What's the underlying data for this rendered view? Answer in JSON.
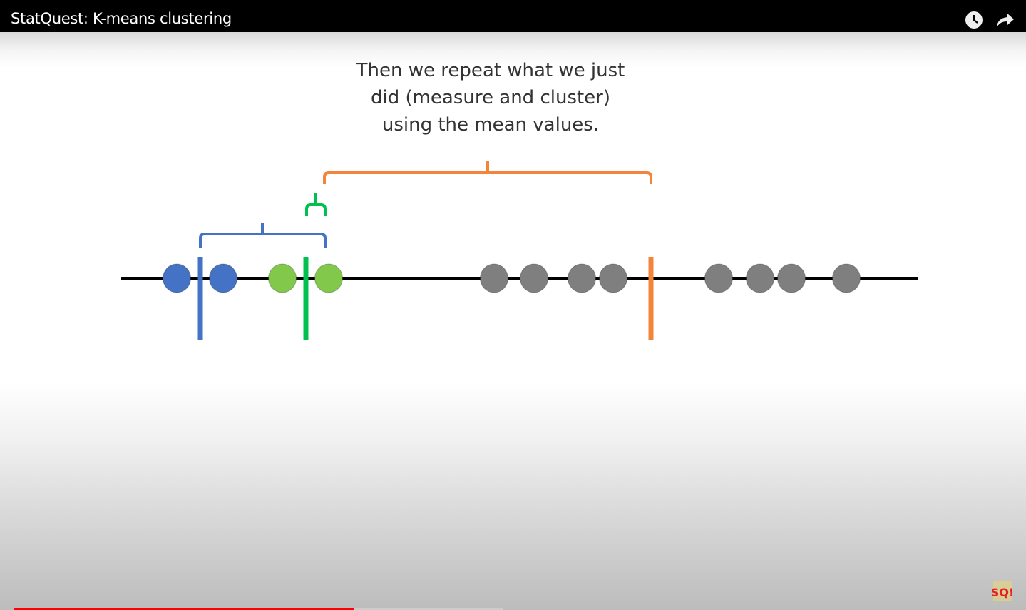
{
  "header": {
    "title": "StatQuest: K-means clustering"
  },
  "icons": {
    "watch_later": "clock-icon",
    "share": "share-arrow-icon"
  },
  "slide": {
    "caption_lines": [
      "Then we repeat what we just",
      "did (measure and cluster)",
      "using the mean values."
    ]
  },
  "colors": {
    "blue": "#4472c4",
    "green": "#00c050",
    "light_green": "#82c84a",
    "orange": "#f4843a",
    "gray": "#7f7f7f",
    "progress": "#ff0000"
  },
  "player": {
    "played_fraction": 0.34,
    "buffered_fraction": 0.49
  },
  "logo": {
    "text": "SQ!"
  }
}
